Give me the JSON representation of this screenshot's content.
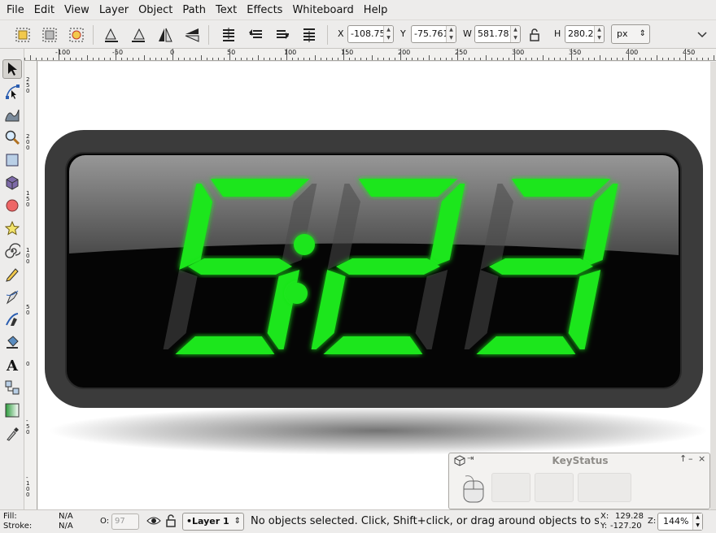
{
  "menu": [
    "File",
    "Edit",
    "View",
    "Layer",
    "Object",
    "Path",
    "Text",
    "Effects",
    "Whiteboard",
    "Help"
  ],
  "toolbar": {
    "x_label": "X",
    "x_value": "-108.75",
    "y_label": "Y",
    "y_value": "-75.761",
    "w_label": "W",
    "w_value": "581.781",
    "h_label": "H",
    "h_value": "280.230",
    "unit": "px"
  },
  "ruler": {
    "h_labels": [
      "-100",
      "-50",
      "0",
      "50",
      "100",
      "150",
      "200",
      "250",
      "300",
      "350",
      "400",
      "450"
    ],
    "v_labels": [
      "250",
      "200",
      "150",
      "100",
      "50",
      "0",
      "-50",
      "-100"
    ]
  },
  "clock": {
    "digits": [
      "5",
      "2",
      "3"
    ],
    "ghost": "8",
    "lit_color": "#1ee61e",
    "ghost_color": "#4a4a4a",
    "bezel_color": "#3b3b3b"
  },
  "keystatus": {
    "title": "KeyStatus"
  },
  "status": {
    "fill_label": "Fill:",
    "fill_value": "N/A",
    "stroke_label": "Stroke:",
    "stroke_value": "N/A",
    "opacity_label": "O:",
    "opacity_value": "97",
    "layer": "•Layer 1",
    "message": "No objects selected. Click, Shift+click, or drag around objects to select.",
    "cursor_x": "129.28",
    "cursor_y": "-127.20",
    "zoom_label": "Z:",
    "zoom": "144%"
  }
}
